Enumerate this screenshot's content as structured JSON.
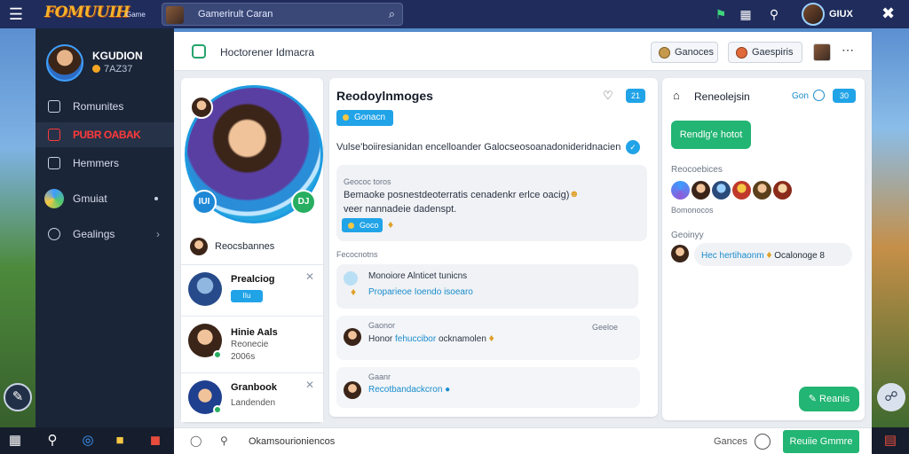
{
  "topbar": {
    "logo": "FOMUUIH",
    "logo_sub": "Game",
    "search_text": "Gamerirult Caran",
    "user_name": "GIUX"
  },
  "sidebar": {
    "profile_name": "KGUDION",
    "profile_sub": "7AZ37",
    "items": [
      {
        "label": "Romunites"
      },
      {
        "label": "PUBR OABAK"
      },
      {
        "label": "Hemmers"
      },
      {
        "label": "Gmuiat"
      },
      {
        "label": "Gealings"
      }
    ]
  },
  "header": {
    "title": "Hoctorener Idmacra",
    "btn1": "Ganoces",
    "btn2": "Gaespiris"
  },
  "profile": {
    "badge_left": "IUI",
    "badge_right": "DJ",
    "name": "Reocsbannes",
    "friends": [
      {
        "name": "Prealciog",
        "tag": "IIu"
      },
      {
        "name": "Hinie Aals",
        "sub1": "Reonecie",
        "sub2": "2006s"
      },
      {
        "name": "Granbook",
        "sub1": "Landenden"
      }
    ]
  },
  "feed": {
    "title": "Reodoylnmoges",
    "chip": "Gonacn",
    "badge": "21",
    "desc": "Vulse'boiiresianidan encelloander Galocseosoanadonideridnacien",
    "post1_meta": "Geococ toros",
    "post1_text1": "Bemaoke posnestdeoterratis cenadenkr erlce oacig)",
    "post1_text2": "veer nannadeie dadenspt.",
    "post1_chip": "Goco",
    "label2": "Fecocnotns",
    "post2_title": "Monoiore Alnticet tunicns",
    "post2_link": "Proparieoe Ioendo isoearo",
    "post3_meta_l": "Gaonor",
    "post3_meta_r": "Geeloe",
    "post3_text": "Honor",
    "post3_link": "fehuccibor",
    "post3_rest": "ocknamolen",
    "post4_meta": "Gaanr",
    "post4_link": "Recotbandackcron"
  },
  "chat": {
    "title": "Reneolejsin",
    "label": "Gon",
    "badge": "30",
    "green_btn": "Rendlg'e hotot",
    "label1": "Reocoebices",
    "label2": "Bomonocos",
    "label3": "Geoinyy",
    "msg_link": "Hec hertihaonm",
    "msg_rest": "Ocalonoge 8",
    "bottom_btn": "Reanis"
  },
  "composer": {
    "placeholder": "Okamsourioniencos",
    "label": "Gances",
    "send": "Reuiie Gmmre"
  }
}
